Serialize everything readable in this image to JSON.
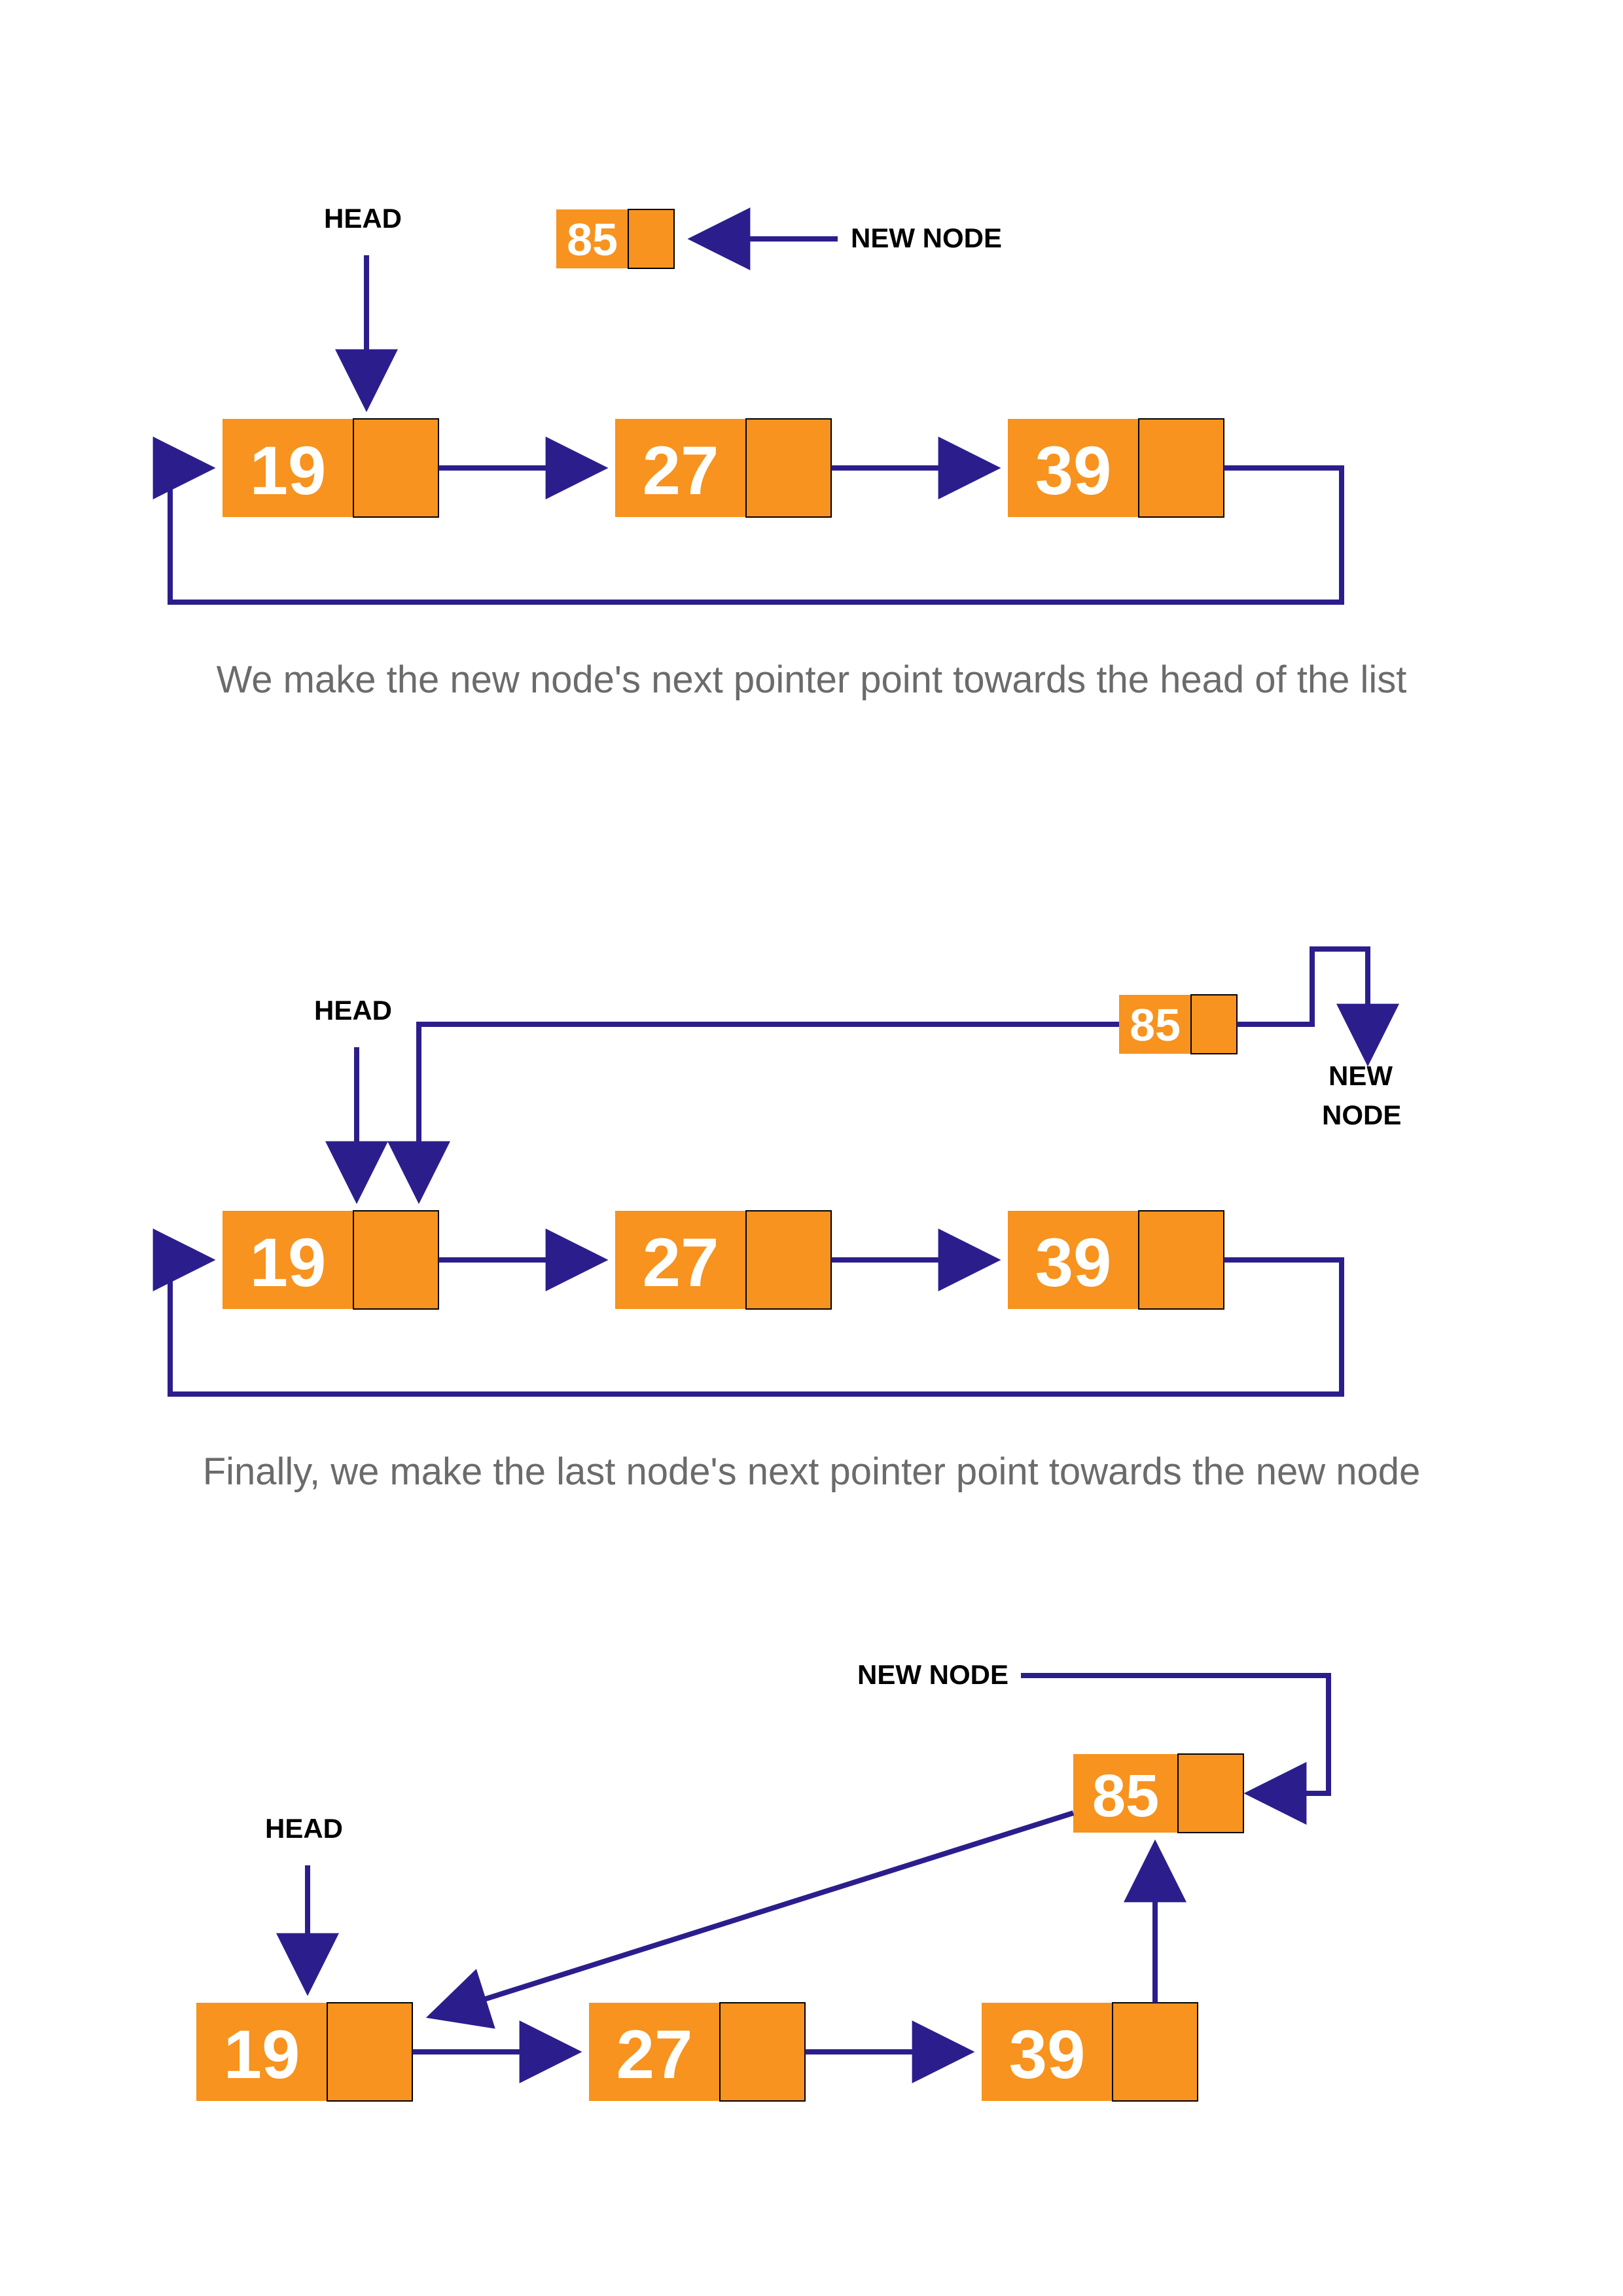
{
  "labels": {
    "head": "HEAD",
    "new_node": "NEW NODE",
    "new": "NEW",
    "node": "NODE"
  },
  "node_values": {
    "n85": "85",
    "n19": "19",
    "n27": "27",
    "n39": "39"
  },
  "captions": {
    "c1": "We make the new node's next pointer point towards the head of the list",
    "c2": "Finally, we make the last node's next pointer point towards the new node"
  },
  "colors": {
    "node_fill": "#F7931E",
    "node_text": "#ffffff",
    "arrow": "#2B1E8C"
  }
}
